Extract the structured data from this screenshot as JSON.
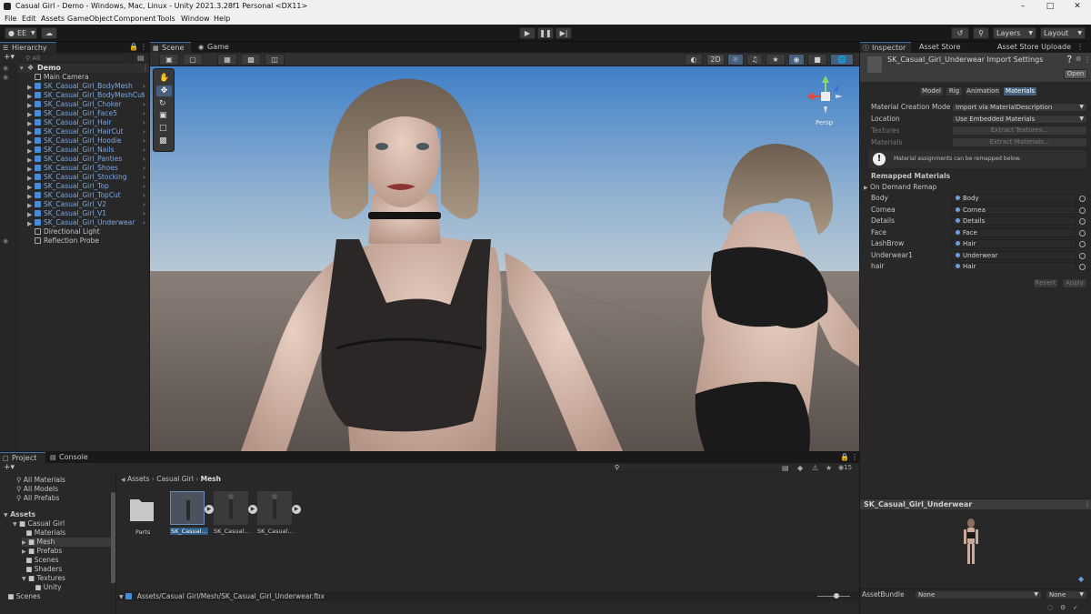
{
  "window": {
    "title": "Casual Girl - Demo - Windows, Mac, Linux - Unity 2021.3.28f1 Personal <DX11>"
  },
  "menu": [
    "File",
    "Edit",
    "Assets",
    "GameObject",
    "Component",
    "Tools",
    "Window",
    "Help"
  ],
  "toolbar": {
    "account": "EE",
    "layers": "Layers",
    "layout": "Layout"
  },
  "hierarchy": {
    "tab": "Hierarchy",
    "search_placeholder": "All",
    "scene": "Demo",
    "items": [
      {
        "label": "Main Camera",
        "prefab": false
      },
      {
        "label": "SK_Casual_Girl_BodyMesh",
        "prefab": true
      },
      {
        "label": "SK_Casual_Girl_BodyMeshCut",
        "prefab": true
      },
      {
        "label": "SK_Casual_Girl_Choker",
        "prefab": true
      },
      {
        "label": "SK_Casual_Girl_Face5",
        "prefab": true
      },
      {
        "label": "SK_Casual_Girl_Hair",
        "prefab": true
      },
      {
        "label": "SK_Casual_Girl_HairCut",
        "prefab": true
      },
      {
        "label": "SK_Casual_Girl_Hoodie",
        "prefab": true
      },
      {
        "label": "SK_Casual_Girl_Nails",
        "prefab": true
      },
      {
        "label": "SK_Casual_Girl_Panties",
        "prefab": true
      },
      {
        "label": "SK_Casual_Girl_Shoes",
        "prefab": true
      },
      {
        "label": "SK_Casual_Girl_Stocking",
        "prefab": true
      },
      {
        "label": "SK_Casual_Girl_Top",
        "prefab": true
      },
      {
        "label": "SK_Casual_Girl_TopCut",
        "prefab": true
      },
      {
        "label": "SK_Casual_Girl_V2",
        "prefab": true
      },
      {
        "label": "SK_Casual_Girl_V1",
        "prefab": true
      },
      {
        "label": "SK_Casual_Girl_Underwear",
        "prefab": true
      },
      {
        "label": "Directional Light",
        "prefab": false
      },
      {
        "label": "Reflection Probe",
        "prefab": false
      }
    ]
  },
  "scene_view": {
    "tabs": [
      "Scene",
      "Game"
    ],
    "mode_2d": "2D",
    "gizmo_label": "Persp"
  },
  "inspector": {
    "tabs": [
      "Inspector",
      "Asset Store Validator",
      "Asset Store Uploade"
    ],
    "title": "SK_Casual_Girl_Underwear Import Settings",
    "open": "Open",
    "subtabs": [
      "Model",
      "Rig",
      "Animation",
      "Materials"
    ],
    "material_creation_mode": {
      "label": "Material Creation Mode",
      "value": "Import via MaterialDescription"
    },
    "location": {
      "label": "Location",
      "value": "Use Embedded Materials"
    },
    "textures": {
      "label": "Textures",
      "button": "Extract Textures..."
    },
    "materials": {
      "label": "Materials",
      "button": "Extract Materials..."
    },
    "info": "Material assignments can be remapped below.",
    "remapped_header": "Remapped Materials",
    "on_demand": "On Demand Remap",
    "remaps": [
      {
        "slot": "Body",
        "material": "Body"
      },
      {
        "slot": "Cornea",
        "material": "Cornea"
      },
      {
        "slot": "Details",
        "material": "Details"
      },
      {
        "slot": "Face",
        "material": "Face"
      },
      {
        "slot": "LashBrow",
        "material": "Hair"
      },
      {
        "slot": "Underwear1",
        "material": "Underwear"
      },
      {
        "slot": "hair",
        "material": "Hair"
      }
    ],
    "revert": "Revert",
    "apply": "Apply",
    "preview_title": "SK_Casual_Girl_Underwear",
    "assetbundle": {
      "label": "AssetBundle",
      "value": "None",
      "variant": "None"
    }
  },
  "project": {
    "tabs": [
      "Project",
      "Console"
    ],
    "favorites": [
      "All Materials",
      "All Models",
      "All Prefabs"
    ],
    "tree_root": "Assets",
    "tree": [
      {
        "label": "Casual Girl",
        "indent": 1
      },
      {
        "label": "Materials",
        "indent": 2
      },
      {
        "label": "Mesh",
        "indent": 2
      },
      {
        "label": "Prefabs",
        "indent": 2
      },
      {
        "label": "Scenes",
        "indent": 2
      },
      {
        "label": "Shaders",
        "indent": 2
      },
      {
        "label": "Textures",
        "indent": 2
      },
      {
        "label": "Unity",
        "indent": 3
      },
      {
        "label": "Scenes",
        "indent": 0
      }
    ],
    "breadcrumb": [
      "Assets",
      "Casual Girl",
      "Mesh"
    ],
    "items": [
      "Parts",
      "SK_Casual...",
      "SK_Casual...",
      "SK_Casual..."
    ],
    "hidden_count": "15",
    "path": "Assets/Casual Girl/Mesh/SK_Casual_Girl_Underwear.fbx"
  }
}
